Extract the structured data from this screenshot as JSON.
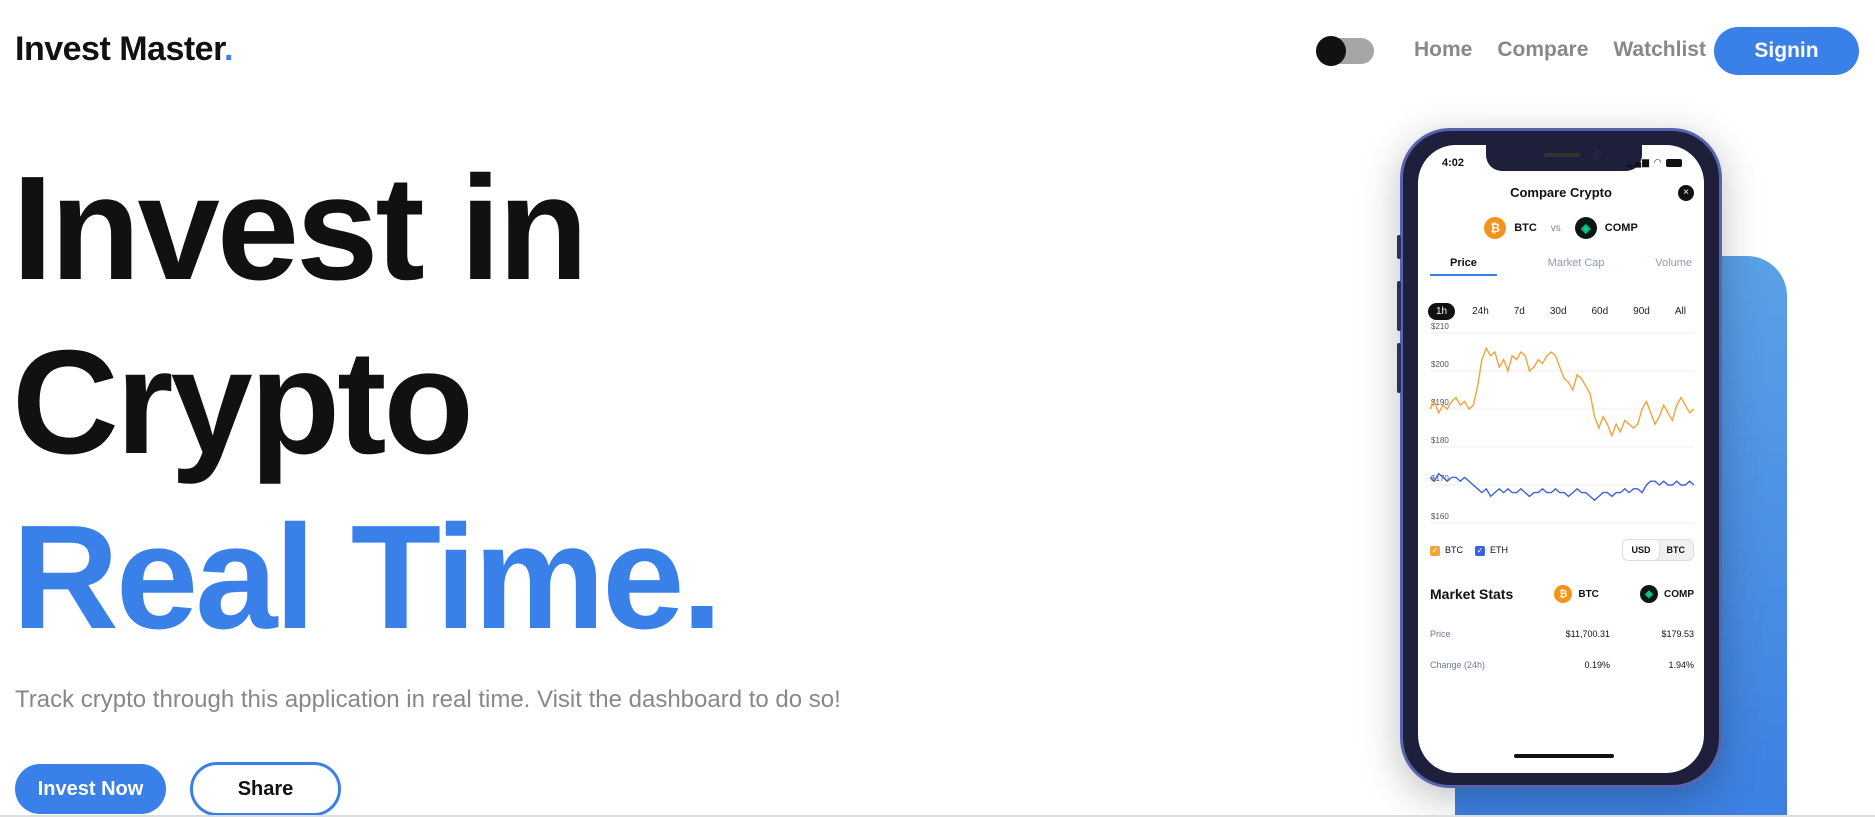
{
  "nav": {
    "logo": "Invest Master",
    "logo_dot": ".",
    "links": [
      "Home",
      "Compare",
      "Watchlist"
    ],
    "signin": "Signin"
  },
  "hero": {
    "line1": "Invest in",
    "line2": "Crypto",
    "line3": "Real Time.",
    "subtitle": "Track crypto through this application in real time. Visit the dashboard to do so!",
    "invest_button": "Invest Now",
    "share_button": "Share"
  },
  "phone": {
    "time": "4:02",
    "title": "Compare Crypto",
    "close": "×",
    "coin_a": "BTC",
    "vs": "vs",
    "coin_b": "COMP",
    "tabs": [
      "Price",
      "Market Cap",
      "Volume"
    ],
    "ranges": [
      "1h",
      "24h",
      "7d",
      "30d",
      "60d",
      "90d",
      "All"
    ],
    "legend": [
      "BTC",
      "ETH"
    ],
    "currency": [
      "USD",
      "BTC"
    ],
    "market_stats": {
      "title": "Market Stats",
      "coin_a": "BTC",
      "coin_b": "COMP",
      "rows": [
        {
          "label": "Price",
          "a": "$11,700.31",
          "b": "$179.53"
        },
        {
          "label": "Change (24h)",
          "a": "0.19%",
          "b": "1.94%"
        }
      ]
    }
  },
  "chart_data": {
    "type": "line",
    "ylim": [
      160,
      210
    ],
    "yticks": [
      "$210",
      "$200",
      "$190",
      "$180",
      "$170",
      "$160"
    ],
    "series": [
      {
        "name": "BTC",
        "color": "#f2a33a",
        "values": [
          190,
          192,
          189,
          191,
          190,
          192,
          193,
          191,
          192,
          190,
          191,
          196,
          203,
          206,
          204,
          205,
          201,
          203,
          200,
          204,
          203,
          205,
          204,
          200,
          201,
          203,
          202,
          204,
          205,
          204,
          201,
          198,
          197,
          195,
          199,
          198,
          196,
          194,
          188,
          185,
          188,
          186,
          183,
          186,
          184,
          187,
          186,
          185,
          186,
          190,
          192,
          189,
          186,
          188,
          191,
          189,
          187,
          191,
          193,
          191,
          189,
          190
        ]
      },
      {
        "name": "ETH",
        "color": "#3b62e0",
        "values": [
          172,
          171,
          173,
          172,
          171,
          172,
          172,
          171,
          172,
          171,
          170,
          169,
          168,
          169,
          167,
          168,
          169,
          168,
          169,
          168,
          168,
          169,
          168,
          167,
          168,
          168,
          169,
          168,
          168,
          169,
          168,
          168,
          167,
          168,
          169,
          168,
          168,
          167,
          166,
          167,
          168,
          168,
          167,
          168,
          168,
          169,
          168,
          169,
          169,
          168,
          170,
          171,
          171,
          170,
          171,
          170,
          170,
          171,
          170,
          170,
          171,
          170
        ]
      }
    ]
  }
}
